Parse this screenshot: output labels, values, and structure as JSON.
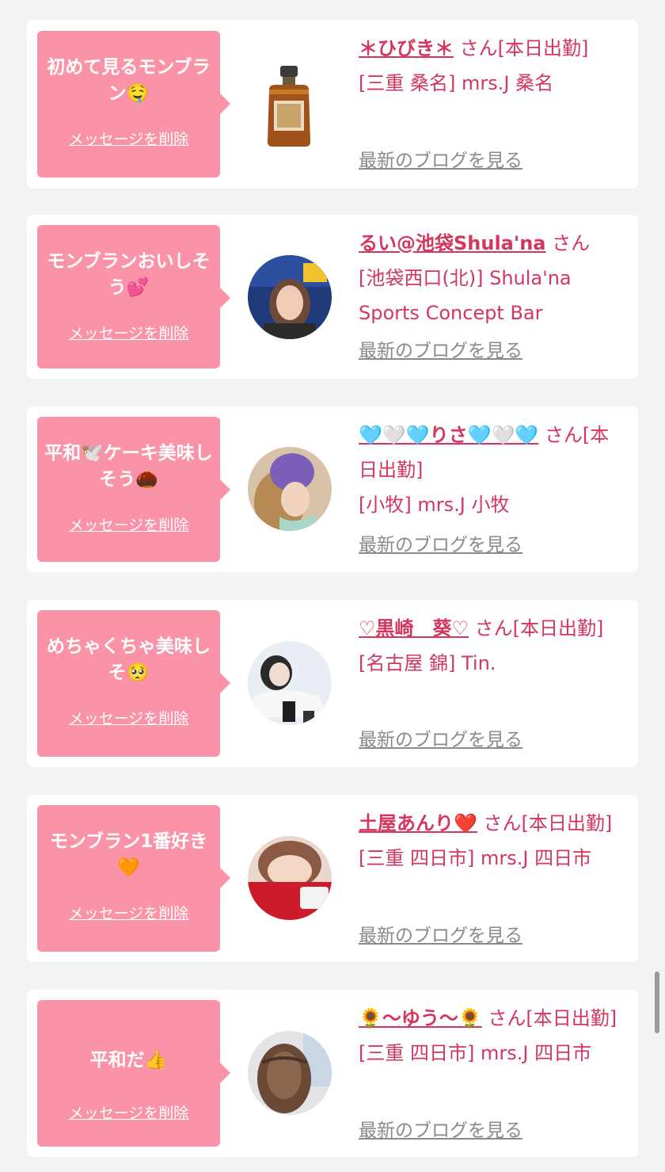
{
  "delete_label": "メッセージを削除",
  "blog_label": "最新のブログを見る",
  "san_suffix": "さん",
  "items": [
    {
      "message": "初めて見るモンブラン🤤",
      "name": "＊ひびき＊",
      "suffix": "さん[本日出勤]",
      "shop": "[三重 桑名] mrs.J 桑名",
      "avatar_icon": "whisky-bottle-icon"
    },
    {
      "message": "モンブランおいしそう💕",
      "name": "るい@池袋Shula'na",
      "suffix": "さん",
      "shop": "[池袋西口(北)] Shula'na Sports Concept Bar",
      "avatar_icon": "profile-photo"
    },
    {
      "message": "平和🕊️ケーキ美味しそう🌰",
      "name": "🩵🤍🩵りさ🩵🤍🩵",
      "suffix": "さん[本日出勤]",
      "shop": "[小牧] mrs.J 小牧",
      "avatar_icon": "profile-photo"
    },
    {
      "message": "めちゃくちゃ美味しそ🥺",
      "name": "♡黒崎　葵♡",
      "suffix": "さん[本日出勤]",
      "shop": "[名古屋 錦] Tin.",
      "avatar_icon": "profile-photo"
    },
    {
      "message": "モンブラン1番好き🧡",
      "name": "土屋あんり❤️",
      "suffix": "さん[本日出勤]",
      "shop": "[三重 四日市] mrs.J 四日市",
      "avatar_icon": "profile-photo"
    },
    {
      "message": "平和だ👍",
      "name": "🌻〜ゆう〜🌻",
      "suffix": "さん[本日出勤]",
      "shop": "[三重 四日市] mrs.J 四日市",
      "avatar_icon": "profile-photo"
    }
  ],
  "colors": {
    "accent": "#d4365e",
    "bubble": "#fb93a8",
    "background": "#f3f3f3",
    "link_gray": "#8a8a8a"
  }
}
